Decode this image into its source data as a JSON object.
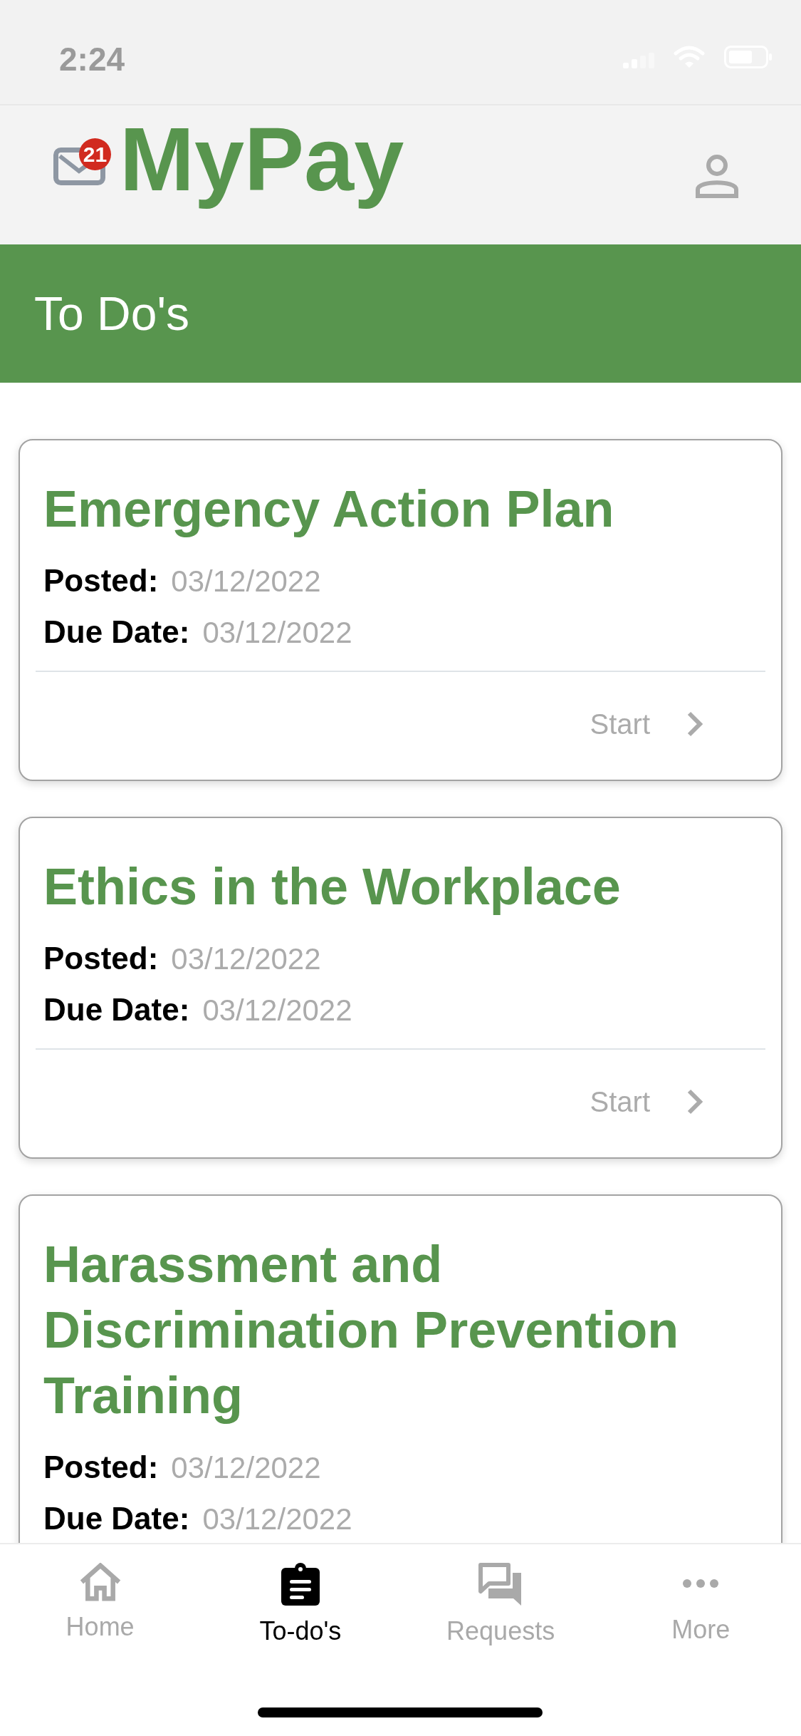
{
  "status_bar": {
    "time": "2:24"
  },
  "header": {
    "mail_badge": "21",
    "app_title": "MyPay"
  },
  "banner": {
    "title": "To Do's"
  },
  "todos": [
    {
      "title": "Emergency Action Plan",
      "posted_label": "Posted:",
      "posted_date": "03/12/2022",
      "due_label": "Due Date:",
      "due_date": "03/12/2022",
      "action": "Start"
    },
    {
      "title": "Ethics in the Workplace",
      "posted_label": "Posted:",
      "posted_date": "03/12/2022",
      "due_label": "Due Date:",
      "due_date": "03/12/2022",
      "action": "Start"
    },
    {
      "title": "Harassment and Discrimination Prevention Training",
      "posted_label": "Posted:",
      "posted_date": "03/12/2022",
      "due_label": "Due Date:",
      "due_date": "03/12/2022"
    }
  ],
  "tab_bar": {
    "tabs": [
      {
        "label": "Home",
        "selected": false
      },
      {
        "label": "To-do's",
        "selected": true
      },
      {
        "label": "Requests",
        "selected": false
      },
      {
        "label": "More",
        "selected": false
      }
    ]
  }
}
